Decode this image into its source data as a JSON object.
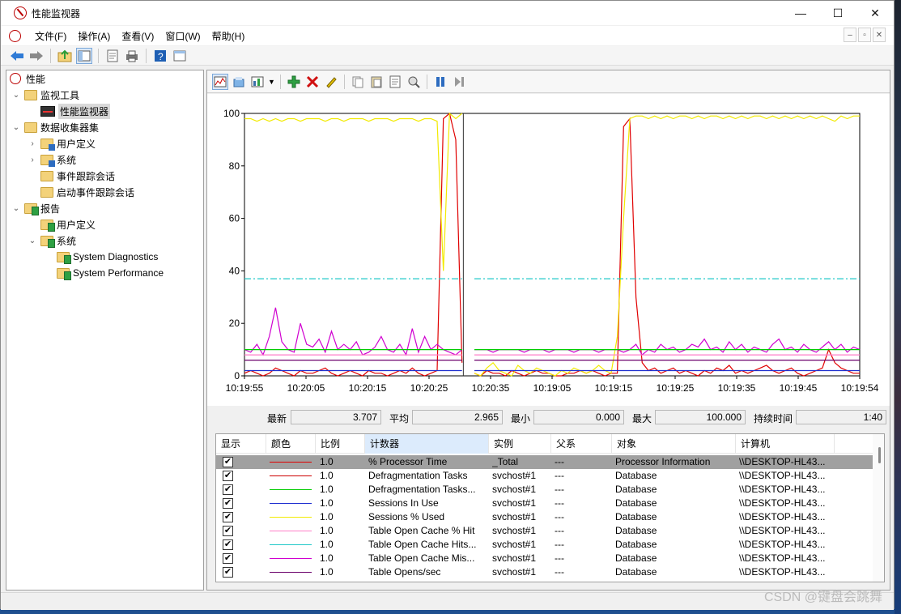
{
  "window": {
    "title": "性能监视器",
    "controls": {
      "minimize": "—",
      "maximize": "☐",
      "close": "✕"
    }
  },
  "menu": {
    "items": [
      "文件(F)",
      "操作(A)",
      "查看(V)",
      "窗口(W)",
      "帮助(H)"
    ]
  },
  "tree": {
    "root": "性能",
    "monitor_tools": "监视工具",
    "perf_monitor": "性能监视器",
    "data_collector_sets": "数据收集器集",
    "dcs_user_defined": "用户定义",
    "dcs_system": "系统",
    "event_trace_sessions": "事件跟踪会话",
    "startup_event_trace": "启动事件跟踪会话",
    "reports": "报告",
    "reports_user_defined": "用户定义",
    "reports_system": "系统",
    "system_diagnostics": "System Diagnostics",
    "system_performance": "System Performance"
  },
  "stats": {
    "last_label": "最新",
    "last_value": "3.707",
    "avg_label": "平均",
    "avg_value": "2.965",
    "min_label": "最小",
    "min_value": "0.000",
    "max_label": "最大",
    "max_value": "100.000",
    "duration_label": "持续时间",
    "duration_value": "1:40"
  },
  "table": {
    "headers": [
      "显示",
      "颜色",
      "比例",
      "计数器",
      "实例",
      "父系",
      "对象",
      "计算机"
    ],
    "rows": [
      {
        "checked": "✔",
        "color": "#e00000",
        "scale": "1.0",
        "counter": "% Processor Time",
        "instance": "_Total",
        "parent": "---",
        "object": "Processor Information",
        "computer": "\\\\DESKTOP-HL43..."
      },
      {
        "checked": "✔",
        "color": "#cc0000",
        "scale": "1.0",
        "counter": "Defragmentation Tasks",
        "instance": "svchost#1",
        "parent": "---",
        "object": "Database",
        "computer": "\\\\DESKTOP-HL43..."
      },
      {
        "checked": "✔",
        "color": "#00cc00",
        "scale": "1.0",
        "counter": "Defragmentation Tasks...",
        "instance": "svchost#1",
        "parent": "---",
        "object": "Database",
        "computer": "\\\\DESKTOP-HL43..."
      },
      {
        "checked": "✔",
        "color": "#1f2fd0",
        "scale": "1.0",
        "counter": "Sessions In Use",
        "instance": "svchost#1",
        "parent": "---",
        "object": "Database",
        "computer": "\\\\DESKTOP-HL43..."
      },
      {
        "checked": "✔",
        "color": "#f2ea00",
        "scale": "1.0",
        "counter": "Sessions % Used",
        "instance": "svchost#1",
        "parent": "---",
        "object": "Database",
        "computer": "\\\\DESKTOP-HL43..."
      },
      {
        "checked": "✔",
        "color": "#ff7fc8",
        "scale": "1.0",
        "counter": "Table Open Cache % Hit",
        "instance": "svchost#1",
        "parent": "---",
        "object": "Database",
        "computer": "\\\\DESKTOP-HL43..."
      },
      {
        "checked": "✔",
        "color": "#20c8c8",
        "scale": "1.0",
        "counter": "Table Open Cache Hits...",
        "instance": "svchost#1",
        "parent": "---",
        "object": "Database",
        "computer": "\\\\DESKTOP-HL43..."
      },
      {
        "checked": "✔",
        "color": "#d000d0",
        "scale": "1.0",
        "counter": "Table Open Cache Mis...",
        "instance": "svchost#1",
        "parent": "---",
        "object": "Database",
        "computer": "\\\\DESKTOP-HL43..."
      },
      {
        "checked": "✔",
        "color": "#6a006a",
        "scale": "1.0",
        "counter": "Table Opens/sec",
        "instance": "svchost#1",
        "parent": "---",
        "object": "Database",
        "computer": "\\\\DESKTOP-HL43..."
      }
    ]
  },
  "chart_data": {
    "type": "line",
    "x_ticks": [
      "10:19:55",
      "10:20:05",
      "10:20:15",
      "10:20:25",
      "10:20:35",
      "10:19:05",
      "10:19:15",
      "10:19:25",
      "10:19:35",
      "10:19:45",
      "10:19:54"
    ],
    "y_ticks": [
      "0",
      "20",
      "40",
      "60",
      "80",
      "100"
    ],
    "ylim": [
      0,
      100
    ],
    "grid": false,
    "series": [
      {
        "name": "% Processor Time",
        "color": "#e00000",
        "values": [
          1,
          2,
          1,
          0,
          1,
          3,
          2,
          1,
          0,
          2,
          1,
          1,
          2,
          3,
          1,
          0,
          1,
          2,
          1,
          0,
          2,
          1,
          1,
          0,
          1,
          2,
          1,
          3,
          1,
          0,
          1,
          2,
          98,
          100,
          90,
          5,
          0,
          1,
          0,
          2,
          1,
          1,
          0,
          2,
          1,
          0,
          1,
          2,
          1,
          1,
          0,
          0,
          1,
          1,
          2,
          1,
          2,
          1,
          0,
          1,
          1,
          95,
          98,
          30,
          5,
          2,
          3,
          1,
          2,
          3,
          1,
          2,
          1,
          0,
          2,
          1,
          3,
          2,
          4,
          1,
          2,
          1,
          2,
          3,
          4,
          2,
          1,
          2,
          3,
          1,
          0,
          1,
          2,
          3,
          10,
          5,
          3,
          2,
          1,
          1
        ]
      },
      {
        "name": "Sessions % Used",
        "color": "#f2ea00",
        "values": [
          98,
          98,
          97,
          98,
          97,
          98,
          97,
          98,
          98,
          97,
          98,
          98,
          98,
          97,
          98,
          98,
          97,
          98,
          98,
          98,
          97,
          98,
          98,
          98,
          97,
          98,
          98,
          98,
          97,
          98,
          98,
          97,
          40,
          100,
          98,
          100,
          2,
          1,
          0,
          3,
          5,
          2,
          1,
          0,
          4,
          2,
          1,
          3,
          2,
          1,
          0,
          2,
          1,
          3,
          2,
          1,
          2,
          4,
          2,
          1,
          15,
          60,
          98,
          99,
          99,
          98,
          99,
          98,
          99,
          98,
          99,
          99,
          98,
          99,
          98,
          99,
          99,
          98,
          99,
          98,
          99,
          98,
          99,
          99,
          98,
          99,
          98,
          99,
          98,
          99,
          98,
          99,
          98,
          99,
          98,
          97,
          99,
          98,
          99,
          99
        ]
      },
      {
        "name": "Table Open Cache Mis...",
        "color": "#d000d0",
        "values": [
          10,
          9,
          12,
          8,
          15,
          26,
          13,
          10,
          9,
          20,
          12,
          11,
          14,
          9,
          17,
          10,
          12,
          10,
          13,
          8,
          9,
          11,
          15,
          10,
          9,
          12,
          8,
          18,
          9,
          15,
          10,
          12,
          10,
          9,
          8,
          10,
          9,
          10,
          10,
          10,
          9,
          10,
          10,
          10,
          10,
          9,
          10,
          10,
          10,
          9,
          10,
          10,
          10,
          9,
          10,
          10,
          10,
          9,
          10,
          10,
          10,
          9,
          10,
          12,
          8,
          10,
          9,
          12,
          10,
          11,
          9,
          10,
          12,
          11,
          14,
          10,
          11,
          9,
          13,
          10,
          12,
          9,
          11,
          10,
          9,
          12,
          14,
          10,
          11,
          9,
          12,
          10,
          9,
          11,
          13,
          10,
          12,
          9,
          11,
          10
        ]
      },
      {
        "name": "Table Open Cache Hits...",
        "color": "#20c8c8",
        "values": [
          37,
          37,
          37,
          37,
          37,
          37,
          37,
          37,
          37,
          37,
          37,
          37,
          37,
          37,
          37,
          37,
          37,
          37,
          37,
          37,
          37,
          37,
          37,
          37,
          37,
          37,
          37,
          37,
          37,
          37,
          37,
          37,
          37,
          37,
          37,
          37,
          37,
          37,
          37,
          37,
          37,
          37,
          37,
          37,
          37,
          37,
          37,
          37,
          37,
          37,
          37,
          37,
          37,
          37,
          37,
          37,
          37,
          37,
          37,
          37,
          37,
          37,
          37,
          37,
          37,
          37,
          37,
          37,
          37,
          37,
          37,
          37,
          37,
          37,
          37,
          37,
          37,
          37,
          37,
          37,
          37,
          37,
          37,
          37,
          37,
          37,
          37,
          37,
          37,
          37,
          37,
          37,
          37,
          37,
          37,
          37,
          37,
          37,
          37,
          37
        ]
      },
      {
        "name": "Defragmentation Tasks...",
        "color": "#00cc00",
        "values": [
          10,
          10,
          10,
          10,
          10,
          10,
          10,
          10,
          10,
          10,
          10,
          10,
          10,
          10,
          10,
          10,
          10,
          10,
          10,
          10,
          10,
          10,
          10,
          10,
          10,
          10,
          10,
          10,
          10,
          10,
          10,
          10,
          10,
          10,
          10,
          10,
          10,
          10,
          10,
          10,
          10,
          10,
          10,
          10,
          10,
          10,
          10,
          10,
          10,
          10,
          10,
          10,
          10,
          10,
          10,
          10,
          10,
          10,
          10,
          10,
          10,
          10,
          10,
          10,
          10,
          10,
          10,
          10,
          10,
          10,
          10,
          10,
          10,
          10,
          10,
          10,
          10,
          10,
          10,
          10,
          10,
          10,
          10,
          10,
          10,
          10,
          10,
          10,
          10,
          10,
          10,
          10,
          10,
          10,
          10,
          10,
          10,
          10,
          10,
          10
        ]
      },
      {
        "name": "Table Open Cache % Hit",
        "color": "#ff7fc8",
        "values": [
          8,
          8,
          8,
          8,
          8,
          8,
          8,
          8,
          8,
          8,
          8,
          8,
          8,
          8,
          8,
          8,
          8,
          8,
          8,
          8,
          8,
          8,
          8,
          8,
          8,
          8,
          8,
          8,
          8,
          8,
          8,
          8,
          8,
          8,
          8,
          8,
          8,
          8,
          8,
          8,
          8,
          8,
          8,
          8,
          8,
          8,
          8,
          8,
          8,
          8,
          8,
          8,
          8,
          8,
          8,
          8,
          8,
          8,
          8,
          8,
          8,
          8,
          8,
          8,
          8,
          8,
          8,
          8,
          8,
          8,
          8,
          8,
          8,
          8,
          8,
          8,
          8,
          8,
          8,
          8,
          8,
          8,
          8,
          8,
          8,
          8,
          8,
          8,
          8,
          8,
          8,
          8,
          8,
          8,
          8,
          8,
          8,
          8,
          8,
          8
        ]
      },
      {
        "name": "Table Opens/sec",
        "color": "#6a006a",
        "values": [
          6,
          6,
          6,
          6,
          6,
          6,
          6,
          6,
          6,
          6,
          6,
          6,
          6,
          6,
          6,
          6,
          6,
          6,
          6,
          6,
          6,
          6,
          6,
          6,
          6,
          6,
          6,
          6,
          6,
          6,
          6,
          6,
          6,
          6,
          6,
          6,
          6,
          6,
          6,
          6,
          6,
          6,
          6,
          6,
          6,
          6,
          6,
          6,
          6,
          6,
          6,
          6,
          6,
          6,
          6,
          6,
          6,
          6,
          6,
          6,
          6,
          6,
          6,
          6,
          6,
          6,
          6,
          6,
          6,
          6,
          6,
          6,
          6,
          6,
          6,
          6,
          6,
          6,
          6,
          6,
          6,
          6,
          6,
          6,
          6,
          6,
          6,
          6,
          6,
          6,
          6,
          6,
          6,
          6,
          6,
          6,
          6,
          6,
          6,
          6
        ]
      },
      {
        "name": "Sessions In Use",
        "color": "#1f2fd0",
        "values": [
          2,
          2,
          2,
          2,
          2,
          2,
          2,
          2,
          2,
          2,
          2,
          2,
          2,
          2,
          2,
          2,
          2,
          2,
          2,
          2,
          2,
          2,
          2,
          2,
          2,
          2,
          2,
          2,
          2,
          2,
          2,
          2,
          2,
          2,
          2,
          2,
          2,
          2,
          2,
          2,
          2,
          2,
          2,
          2,
          2,
          2,
          2,
          2,
          2,
          2,
          2,
          2,
          2,
          2,
          2,
          2,
          2,
          2,
          2,
          2,
          2,
          2,
          2,
          2,
          2,
          2,
          2,
          2,
          2,
          2,
          2,
          2,
          2,
          2,
          2,
          2,
          2,
          2,
          2,
          2,
          2,
          2,
          2,
          2,
          2,
          2,
          2,
          2,
          2,
          2,
          2,
          2,
          2,
          2,
          2,
          2,
          2,
          2,
          2,
          2
        ]
      }
    ]
  },
  "watermark": "CSDN @键盘会跳舞"
}
